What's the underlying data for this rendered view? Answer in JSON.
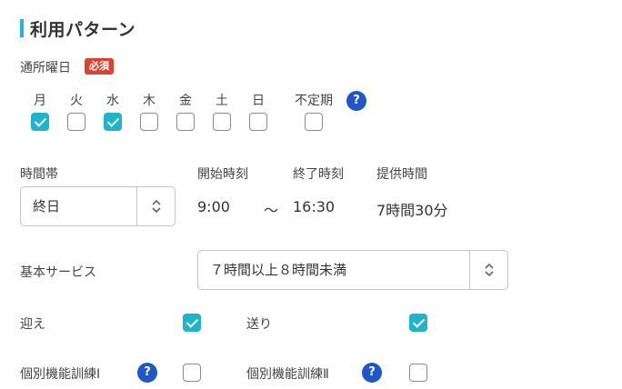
{
  "section": {
    "title": "利用パターン"
  },
  "days_field": {
    "label": "通所曜日",
    "required_badge": "必須",
    "days": [
      {
        "label": "月",
        "checked": true
      },
      {
        "label": "火",
        "checked": false
      },
      {
        "label": "水",
        "checked": true
      },
      {
        "label": "木",
        "checked": false
      },
      {
        "label": "金",
        "checked": false
      },
      {
        "label": "土",
        "checked": false
      },
      {
        "label": "日",
        "checked": false
      },
      {
        "label": "不定期",
        "checked": false
      }
    ],
    "help_glyph": "?"
  },
  "time": {
    "band_label": "時間帯",
    "band_value": "終日",
    "start_label": "開始時刻",
    "start_value": "9:00",
    "separator": "〜",
    "end_label": "終了時刻",
    "end_value": "16:30",
    "duration_label": "提供時間",
    "duration_value": "7時間30分"
  },
  "service": {
    "label": "基本サービス",
    "value": "７時間以上８時間未満"
  },
  "options": {
    "pickup_label": "迎え",
    "pickup_checked": true,
    "dropoff_label": "送り",
    "dropoff_checked": true,
    "training1_label": "個別機能訓練Ⅰ",
    "training1_checked": false,
    "training2_label": "個別機能訓練Ⅱ",
    "training2_checked": false,
    "help_glyph": "?"
  },
  "colors": {
    "accent": "#1fb4cc",
    "required": "#e0402e",
    "help": "#1f56c8"
  }
}
